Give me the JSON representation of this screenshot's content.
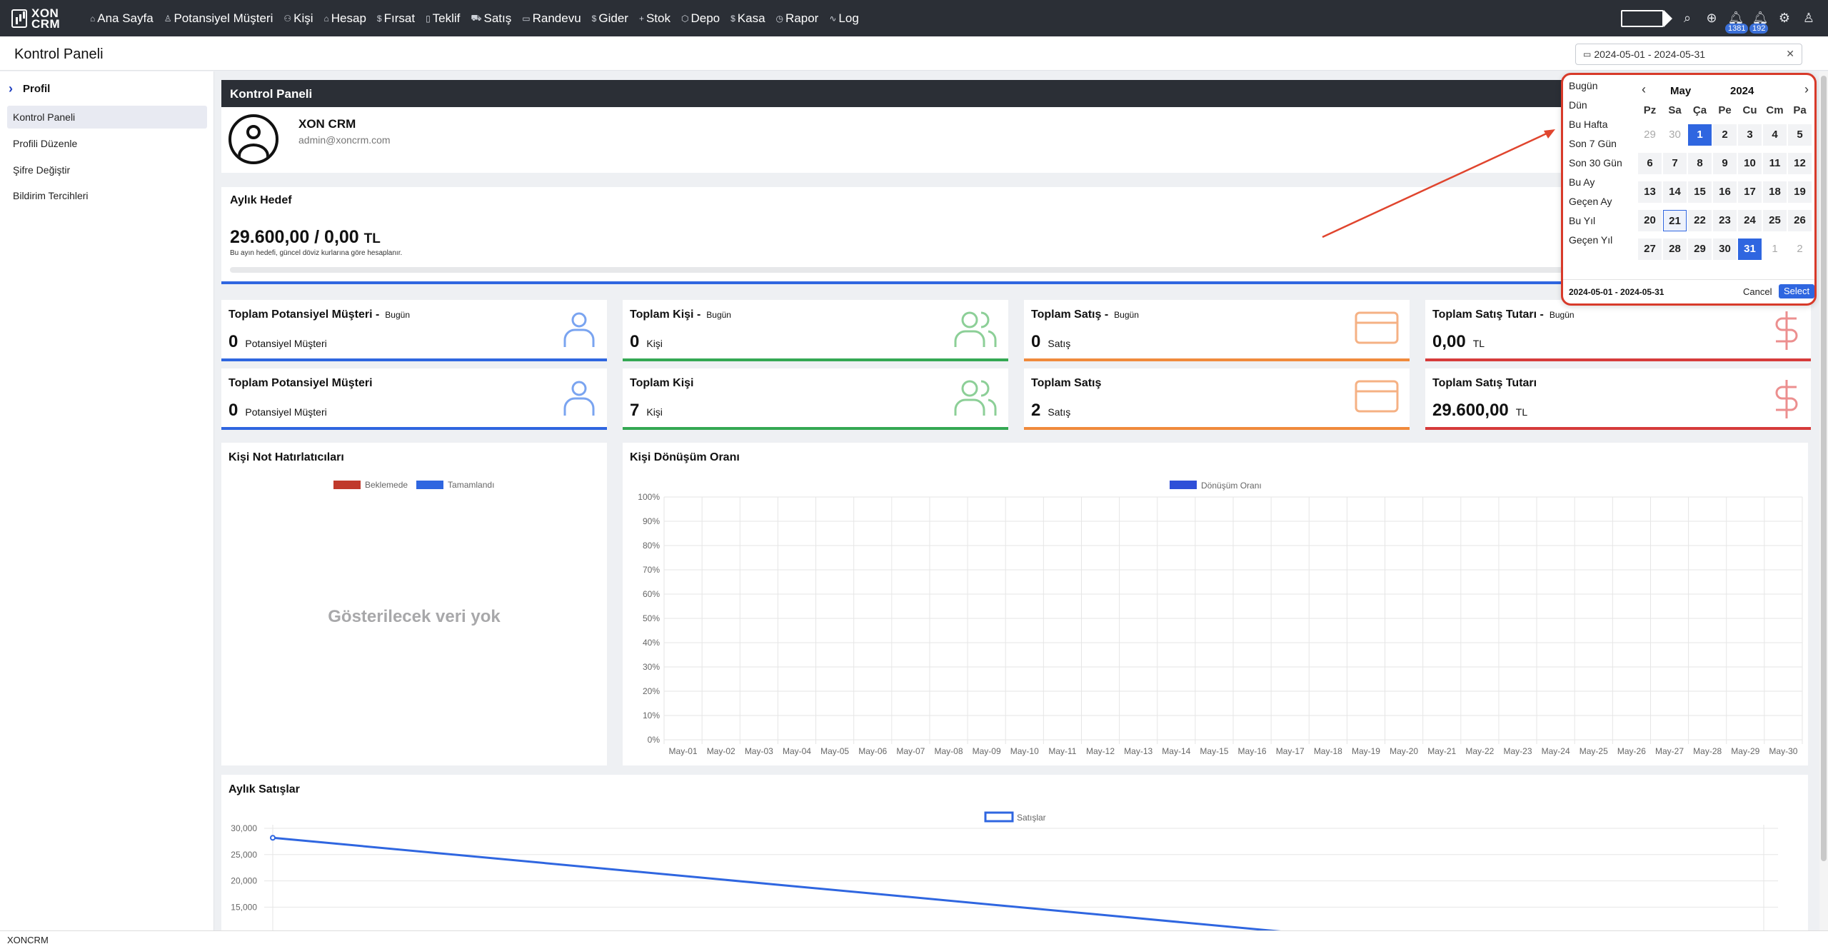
{
  "app": {
    "logo_line1": "XON",
    "logo_line2": "CRM"
  },
  "nav": [
    {
      "label": "Ana Sayfa",
      "icon": "home-icon",
      "glyph": "⌂"
    },
    {
      "label": "Potansiyel Müşteri",
      "icon": "user-icon",
      "glyph": "♙"
    },
    {
      "label": "Kişi",
      "icon": "users-icon",
      "glyph": "⚇"
    },
    {
      "label": "Hesap",
      "icon": "bank-icon",
      "glyph": "⌂"
    },
    {
      "label": "Fırsat",
      "icon": "dollar-icon",
      "glyph": "$"
    },
    {
      "label": "Teklif",
      "icon": "document-icon",
      "glyph": "▯"
    },
    {
      "label": "Satış",
      "icon": "cart-icon",
      "glyph": "⛟"
    },
    {
      "label": "Randevu",
      "icon": "calendar-icon",
      "glyph": "▭"
    },
    {
      "label": "Gider",
      "icon": "dollar-icon",
      "glyph": "$"
    },
    {
      "label": "Stok",
      "icon": "plus-icon",
      "glyph": "+"
    },
    {
      "label": "Depo",
      "icon": "box-icon",
      "glyph": "⬡"
    },
    {
      "label": "Kasa",
      "icon": "dollar-icon",
      "glyph": "$"
    },
    {
      "label": "Rapor",
      "icon": "clock-icon",
      "glyph": "◷"
    },
    {
      "label": "Log",
      "icon": "activity-icon",
      "glyph": "∿"
    }
  ],
  "top_icons": {
    "badge1": "1381",
    "badge2": "192"
  },
  "page": {
    "title": "Kontrol Paneli",
    "date_range": "2024-05-01 - 2024-05-31"
  },
  "sidebar": {
    "header": "Profil",
    "items": [
      "Kontrol Paneli",
      "Profili Düzenle",
      "Şifre Değiştir",
      "Bildirim Tercihleri"
    ]
  },
  "dashboard": {
    "section_title": "Kontrol Paneli",
    "user": {
      "name": "XON CRM",
      "email": "admin@xoncrm.com"
    },
    "goal": {
      "title": "Aylık Hedef",
      "value": "29.600,00 / 0,00",
      "currency": "TL",
      "note": "Bu ayın hedefi, güncel döviz kurlarına göre hesaplanır.",
      "progress": 0
    }
  },
  "stats": [
    {
      "title": "Toplam Potansiyel Müşteri -",
      "tag": "Bugün",
      "value": "0",
      "unit": "Potansiyel Müşteri"
    },
    {
      "title": "Toplam Kişi -",
      "tag": "Bugün",
      "value": "0",
      "unit": "Kişi"
    },
    {
      "title": "Toplam Satış -",
      "tag": "Bugün",
      "value": "0",
      "unit": "Satış"
    },
    {
      "title": "Toplam Satış Tutarı -",
      "tag": "Bugün",
      "value": "0,00",
      "unit": "TL"
    },
    {
      "title": "Toplam Potansiyel Müşteri",
      "tag": "",
      "value": "0",
      "unit": "Potansiyel Müşteri"
    },
    {
      "title": "Toplam Kişi",
      "tag": "",
      "value": "7",
      "unit": "Kişi"
    },
    {
      "title": "Toplam Satış",
      "tag": "",
      "value": "2",
      "unit": "Satış"
    },
    {
      "title": "Toplam Satış Tutarı",
      "tag": "",
      "value": "29.600,00",
      "unit": "TL"
    }
  ],
  "reminders": {
    "title": "Kişi Not Hatırlatıcıları",
    "legend": [
      "Beklemede",
      "Tamamlandı"
    ],
    "colors": [
      "#c0392b",
      "#2f66e0"
    ],
    "empty": "Gösterilecek veri yok"
  },
  "chart_data": [
    {
      "type": "bar",
      "title": "Kişi Dönüşüm Oranı",
      "series": [
        {
          "name": "Dönüşüm Oranı",
          "values": []
        }
      ],
      "categories": [
        "May-01",
        "May-02",
        "May-03",
        "May-04",
        "May-05",
        "May-06",
        "May-07",
        "May-08",
        "May-09",
        "May-10",
        "May-11",
        "May-12",
        "May-13",
        "May-14",
        "May-15",
        "May-16",
        "May-17",
        "May-18",
        "May-19",
        "May-20",
        "May-21",
        "May-22",
        "May-23",
        "May-24",
        "May-25",
        "May-26",
        "May-27",
        "May-28",
        "May-29",
        "May-30"
      ],
      "yticks": [
        "100%",
        "90%",
        "80%",
        "70%",
        "60%",
        "50%",
        "40%",
        "30%",
        "20%",
        "10%",
        "0%"
      ],
      "ylim": [
        0,
        100
      ],
      "grid": true,
      "legend": "top-center",
      "color": "#2f4fd8"
    },
    {
      "type": "line",
      "title": "Aylık Satışlar",
      "series": [
        {
          "name": "Satışlar",
          "points": [
            {
              "x": 0,
              "y": 28200
            },
            {
              "x": 1,
              "y": 9000
            }
          ]
        }
      ],
      "yticks": [
        "30,000",
        "25,000",
        "20,000",
        "15,000"
      ],
      "ylim": [
        0,
        30000
      ],
      "grid": true,
      "legend": "top-center",
      "color": "#2f66e0"
    }
  ],
  "datepicker": {
    "ranges": [
      "Bugün",
      "Dün",
      "Bu Hafta",
      "Son 7 Gün",
      "Son 30 Gün",
      "Bu Ay",
      "Geçen Ay",
      "Bu Yıl",
      "Geçen Yıl"
    ],
    "month": "May",
    "year": "2024",
    "dow": [
      "Pz",
      "Sa",
      "Ça",
      "Pe",
      "Cu",
      "Cm",
      "Pa"
    ],
    "weeks": [
      [
        "29",
        "30",
        "1",
        "2",
        "3",
        "4",
        "5"
      ],
      [
        "6",
        "7",
        "8",
        "9",
        "10",
        "11",
        "12"
      ],
      [
        "13",
        "14",
        "15",
        "16",
        "17",
        "18",
        "19"
      ],
      [
        "20",
        "21",
        "22",
        "23",
        "24",
        "25",
        "26"
      ],
      [
        "27",
        "28",
        "29",
        "30",
        "31",
        "1",
        "2"
      ]
    ],
    "selected_label": "2024-05-01 - 2024-05-31",
    "cancel": "Cancel",
    "select": "Select"
  },
  "footer": {
    "text": "XONCRM"
  }
}
